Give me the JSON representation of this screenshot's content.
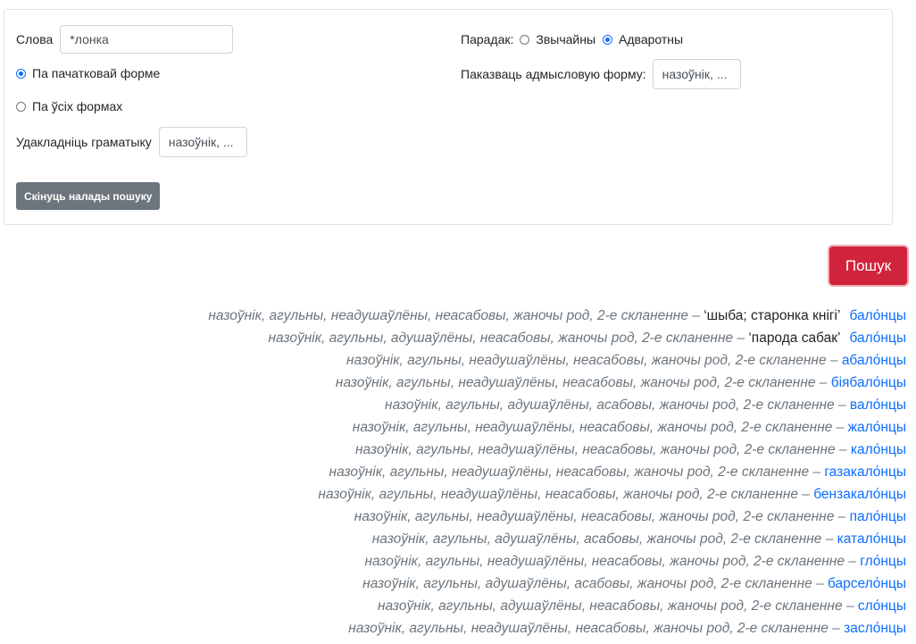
{
  "form": {
    "word_label": "Слова",
    "word_value": "*лонка",
    "radio_lemma": "Па пачатковай форме",
    "radio_all": "Па ўсіх формах",
    "grammar_label": "Удакладніць граматыку",
    "grammar_value": "назоўнік, ...",
    "reset_button": "Скінуць налады пошуку",
    "order_label": "Парадак:",
    "order_normal": "Звычайны",
    "order_reverse": "Адваротны",
    "special_form_label": "Паказваць адмысловую форму:",
    "special_form_value": "назоўнік, ..."
  },
  "search_button": "Пошук",
  "results": [
    {
      "grammar": "назоўнік, агульны, неадушаўлёны, неасабовы, жаночы род, 2-е скланенне – ",
      "meaning": "‘шыба; старонка кнігі’",
      "word": "бало́нцы"
    },
    {
      "grammar": "назоўнік, агульны, адушаўлёны, неасабовы, жаночы род, 2-е скланенне – ",
      "meaning": "‘парода сабак’",
      "word": "бало́нцы"
    },
    {
      "grammar": "назоўнік, агульны, неадушаўлёны, неасабовы, жаночы род, 2-е скланенне – ",
      "word": "абало́нцы"
    },
    {
      "grammar": "назоўнік, агульны, неадушаўлёны, неасабовы, жаночы род, 2-е скланенне – ",
      "word": "біябало́нцы"
    },
    {
      "grammar": "назоўнік, агульны, адушаўлёны, асабовы, жаночы род, 2-е скланенне – ",
      "word": "вало́нцы"
    },
    {
      "grammar": "назоўнік, агульны, неадушаўлёны, неасабовы, жаночы род, 2-е скланенне – ",
      "word": "жало́нцы"
    },
    {
      "grammar": "назоўнік, агульны, неадушаўлёны, неасабовы, жаночы род, 2-е скланенне – ",
      "word": "кало́нцы"
    },
    {
      "grammar": "назоўнік, агульны, неадушаўлёны, неасабовы, жаночы род, 2-е скланенне – ",
      "word": "газакало́нцы"
    },
    {
      "grammar": "назоўнік, агульны, неадушаўлёны, неасабовы, жаночы род, 2-е скланенне – ",
      "word": "бензакало́нцы"
    },
    {
      "grammar": "назоўнік, агульны, неадушаўлёны, неасабовы, жаночы род, 2-е скланенне – ",
      "word": "пало́нцы"
    },
    {
      "grammar": "назоўнік, агульны, адушаўлёны, асабовы, жаночы род, 2-е скланенне – ",
      "word": "катало́нцы"
    },
    {
      "grammar": "назоўнік, агульны, неадушаўлёны, неасабовы, жаночы род, 2-е скланенне – ",
      "word": "гло́нцы"
    },
    {
      "grammar": "назоўнік, агульны, адушаўлёны, асабовы, жаночы род, 2-е скланенне – ",
      "word": "барсело́нцы"
    },
    {
      "grammar": "назоўнік, агульны, адушаўлёны, неасабовы, жаночы род, 2-е скланенне – ",
      "word": "сло́нцы"
    },
    {
      "grammar": "назоўнік, агульны, неадушаўлёны, неасабовы, жаночы род, 2-е скланенне – ",
      "word": "засло́нцы"
    }
  ]
}
